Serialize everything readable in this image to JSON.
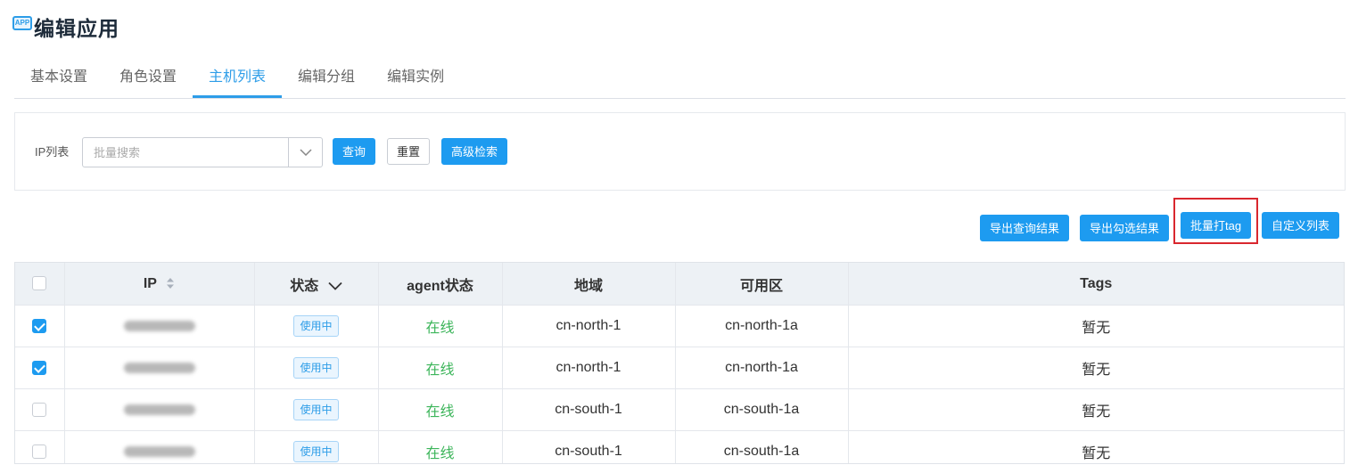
{
  "header": {
    "app_icon_text": "APP",
    "title": "编辑应用"
  },
  "tabs": [
    {
      "label": "基本设置",
      "active": false
    },
    {
      "label": "角色设置",
      "active": false
    },
    {
      "label": "主机列表",
      "active": true
    },
    {
      "label": "编辑分组",
      "active": false
    },
    {
      "label": "编辑实例",
      "active": false
    }
  ],
  "search": {
    "label": "IP列表",
    "placeholder": "批量搜索",
    "value": "",
    "query_button": "查询",
    "reset_button": "重置",
    "advanced_button": "高级检索"
  },
  "toolbar": {
    "export_query_button": "导出查询结果",
    "export_selected_button": "导出勾选结果",
    "batch_tag_button": "批量打tag",
    "custom_columns_button": "自定义列表"
  },
  "table": {
    "headers": {
      "ip": "IP",
      "status": "状态",
      "agent_status": "agent状态",
      "region": "地域",
      "zone": "可用区",
      "tags": "Tags"
    },
    "rows": [
      {
        "checked": true,
        "status": "使用中",
        "agent_status": "在线",
        "region": "cn-north-1",
        "zone": "cn-north-1a",
        "tags": "暂无"
      },
      {
        "checked": true,
        "status": "使用中",
        "agent_status": "在线",
        "region": "cn-north-1",
        "zone": "cn-north-1a",
        "tags": "暂无"
      },
      {
        "checked": false,
        "status": "使用中",
        "agent_status": "在线",
        "region": "cn-south-1",
        "zone": "cn-south-1a",
        "tags": "暂无"
      },
      {
        "checked": false,
        "status": "使用中",
        "agent_status": "在线",
        "region": "cn-south-1",
        "zone": "cn-south-1a",
        "tags": "暂无"
      }
    ]
  },
  "colors": {
    "accent": "#1d9bf0",
    "online": "#3cb55a",
    "highlight": "#d9272e",
    "header_bg": "#edf1f5"
  }
}
